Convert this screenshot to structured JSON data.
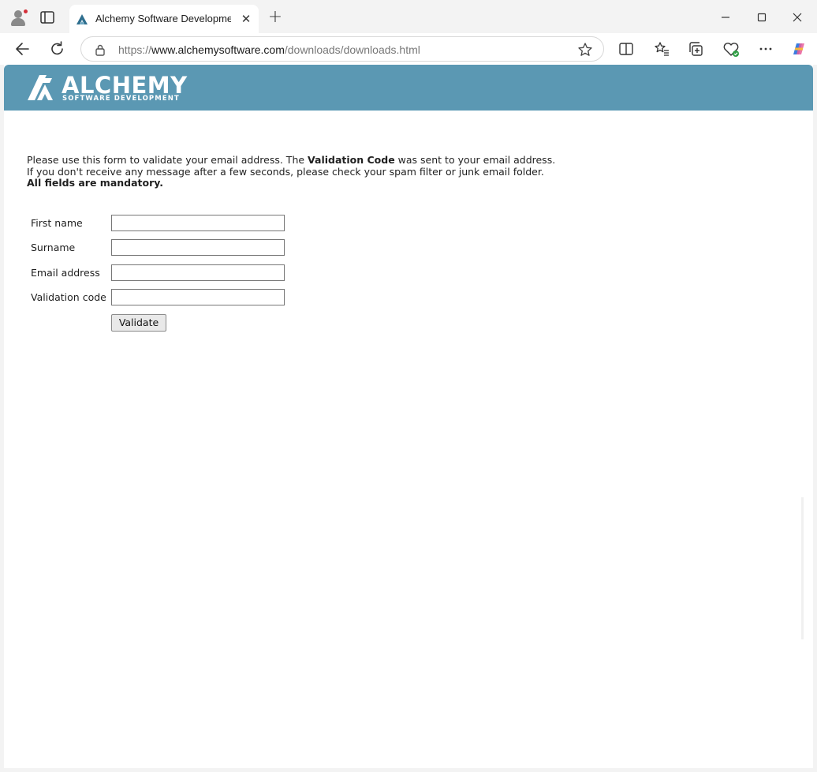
{
  "browser": {
    "tab_title": "Alchemy Software Development |",
    "tab_close": "✕",
    "new_tab": "+",
    "url_prefix": "https://",
    "url_host": "www.alchemysoftware.com",
    "url_path": "/downloads/downloads.html",
    "icons": {
      "profile": "profile-avatar-icon",
      "tabs": "tab-actions-icon",
      "back": "back-arrow-icon",
      "refresh": "refresh-icon",
      "lock": "lock-icon",
      "favorite": "star-icon",
      "split": "split-screen-icon",
      "favorites": "favorites-icon",
      "collections": "collections-icon",
      "health": "browser-essentials-icon",
      "more": "more-icon",
      "copilot": "copilot-icon"
    }
  },
  "site": {
    "logo_text": "ALCHEMY",
    "logo_subtext": "SOFTWARE  DEVELOPMENT",
    "banner_color": "#5b98b3"
  },
  "intro": {
    "line1_pre": "Please use this form to validate your email address. The ",
    "line1_bold": "Validation Code",
    "line1_post": " was sent to your email address.",
    "line2": "If you don't receive any message after a few seconds, please check your spam filter or junk email folder.",
    "line3_bold": "All fields are mandatory."
  },
  "form": {
    "fields": [
      {
        "label": "First name",
        "value": ""
      },
      {
        "label": "Surname",
        "value": ""
      },
      {
        "label": "Email address",
        "value": ""
      },
      {
        "label": "Validation code",
        "value": ""
      }
    ],
    "submit_label": "Validate"
  }
}
